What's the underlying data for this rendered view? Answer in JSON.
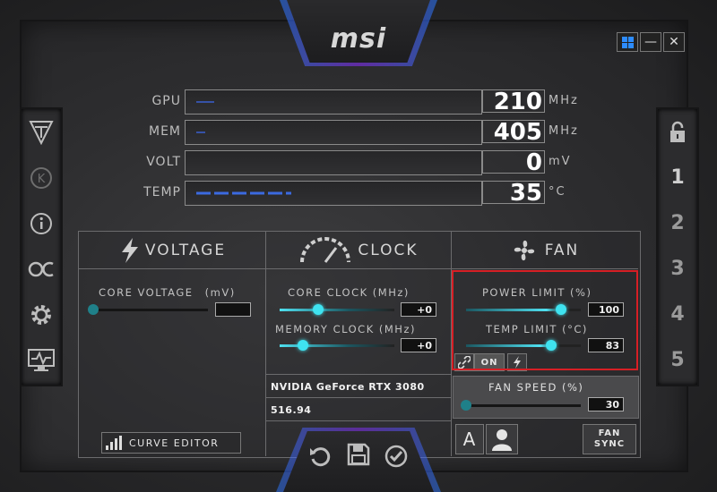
{
  "app": {
    "logo": "msi"
  },
  "window_controls": {
    "windows_icon": "windows-icon",
    "minimize": "—",
    "close": "✕"
  },
  "left_sidebar": [
    "oc-scanner-icon",
    "k-boost-icon",
    "info-icon",
    "oc-icon",
    "settings-icon",
    "monitor-icon"
  ],
  "right_sidebar": {
    "lock_icon": "lock-icon",
    "profiles": [
      "1",
      "2",
      "3",
      "4",
      "5"
    ]
  },
  "meters": [
    {
      "label": "GPU",
      "value": "210",
      "unit": "MHz"
    },
    {
      "label": "MEM",
      "value": "405",
      "unit": "MHz"
    },
    {
      "label": "VOLT",
      "value": "0",
      "unit": "mV"
    },
    {
      "label": "TEMP",
      "value": "35",
      "unit": "°C"
    }
  ],
  "sections": {
    "voltage": "VOLTAGE",
    "clock": "CLOCK",
    "fan": "FAN"
  },
  "voltage": {
    "core_voltage_label": "CORE VOLTAGE",
    "core_voltage_unit": "(mV)",
    "core_voltage_value": ""
  },
  "clock": {
    "core_label": "CORE CLOCK (MHz)",
    "core_value": "+0",
    "memory_label": "MEMORY CLOCK (MHz)",
    "memory_value": "+0"
  },
  "power": {
    "power_label": "POWER LIMIT (%)",
    "power_value": "100",
    "temp_label": "TEMP LIMIT (°C)",
    "temp_value": "83",
    "link_on": "ON"
  },
  "gpu_info": {
    "name": "NVIDIA GeForce RTX 3080",
    "driver": "516.94"
  },
  "fan": {
    "label": "FAN SPEED (%)",
    "value": "30",
    "auto_label": "A",
    "sync_line1": "FAN",
    "sync_line2": "SYNC"
  },
  "curve_editor": {
    "label": "CURVE EDITOR"
  },
  "bottom": {
    "reset": "reset-icon",
    "save": "save-icon",
    "apply": "apply-icon"
  },
  "colors": {
    "accent": "#3fe3f0",
    "highlight": "#d71f25"
  }
}
